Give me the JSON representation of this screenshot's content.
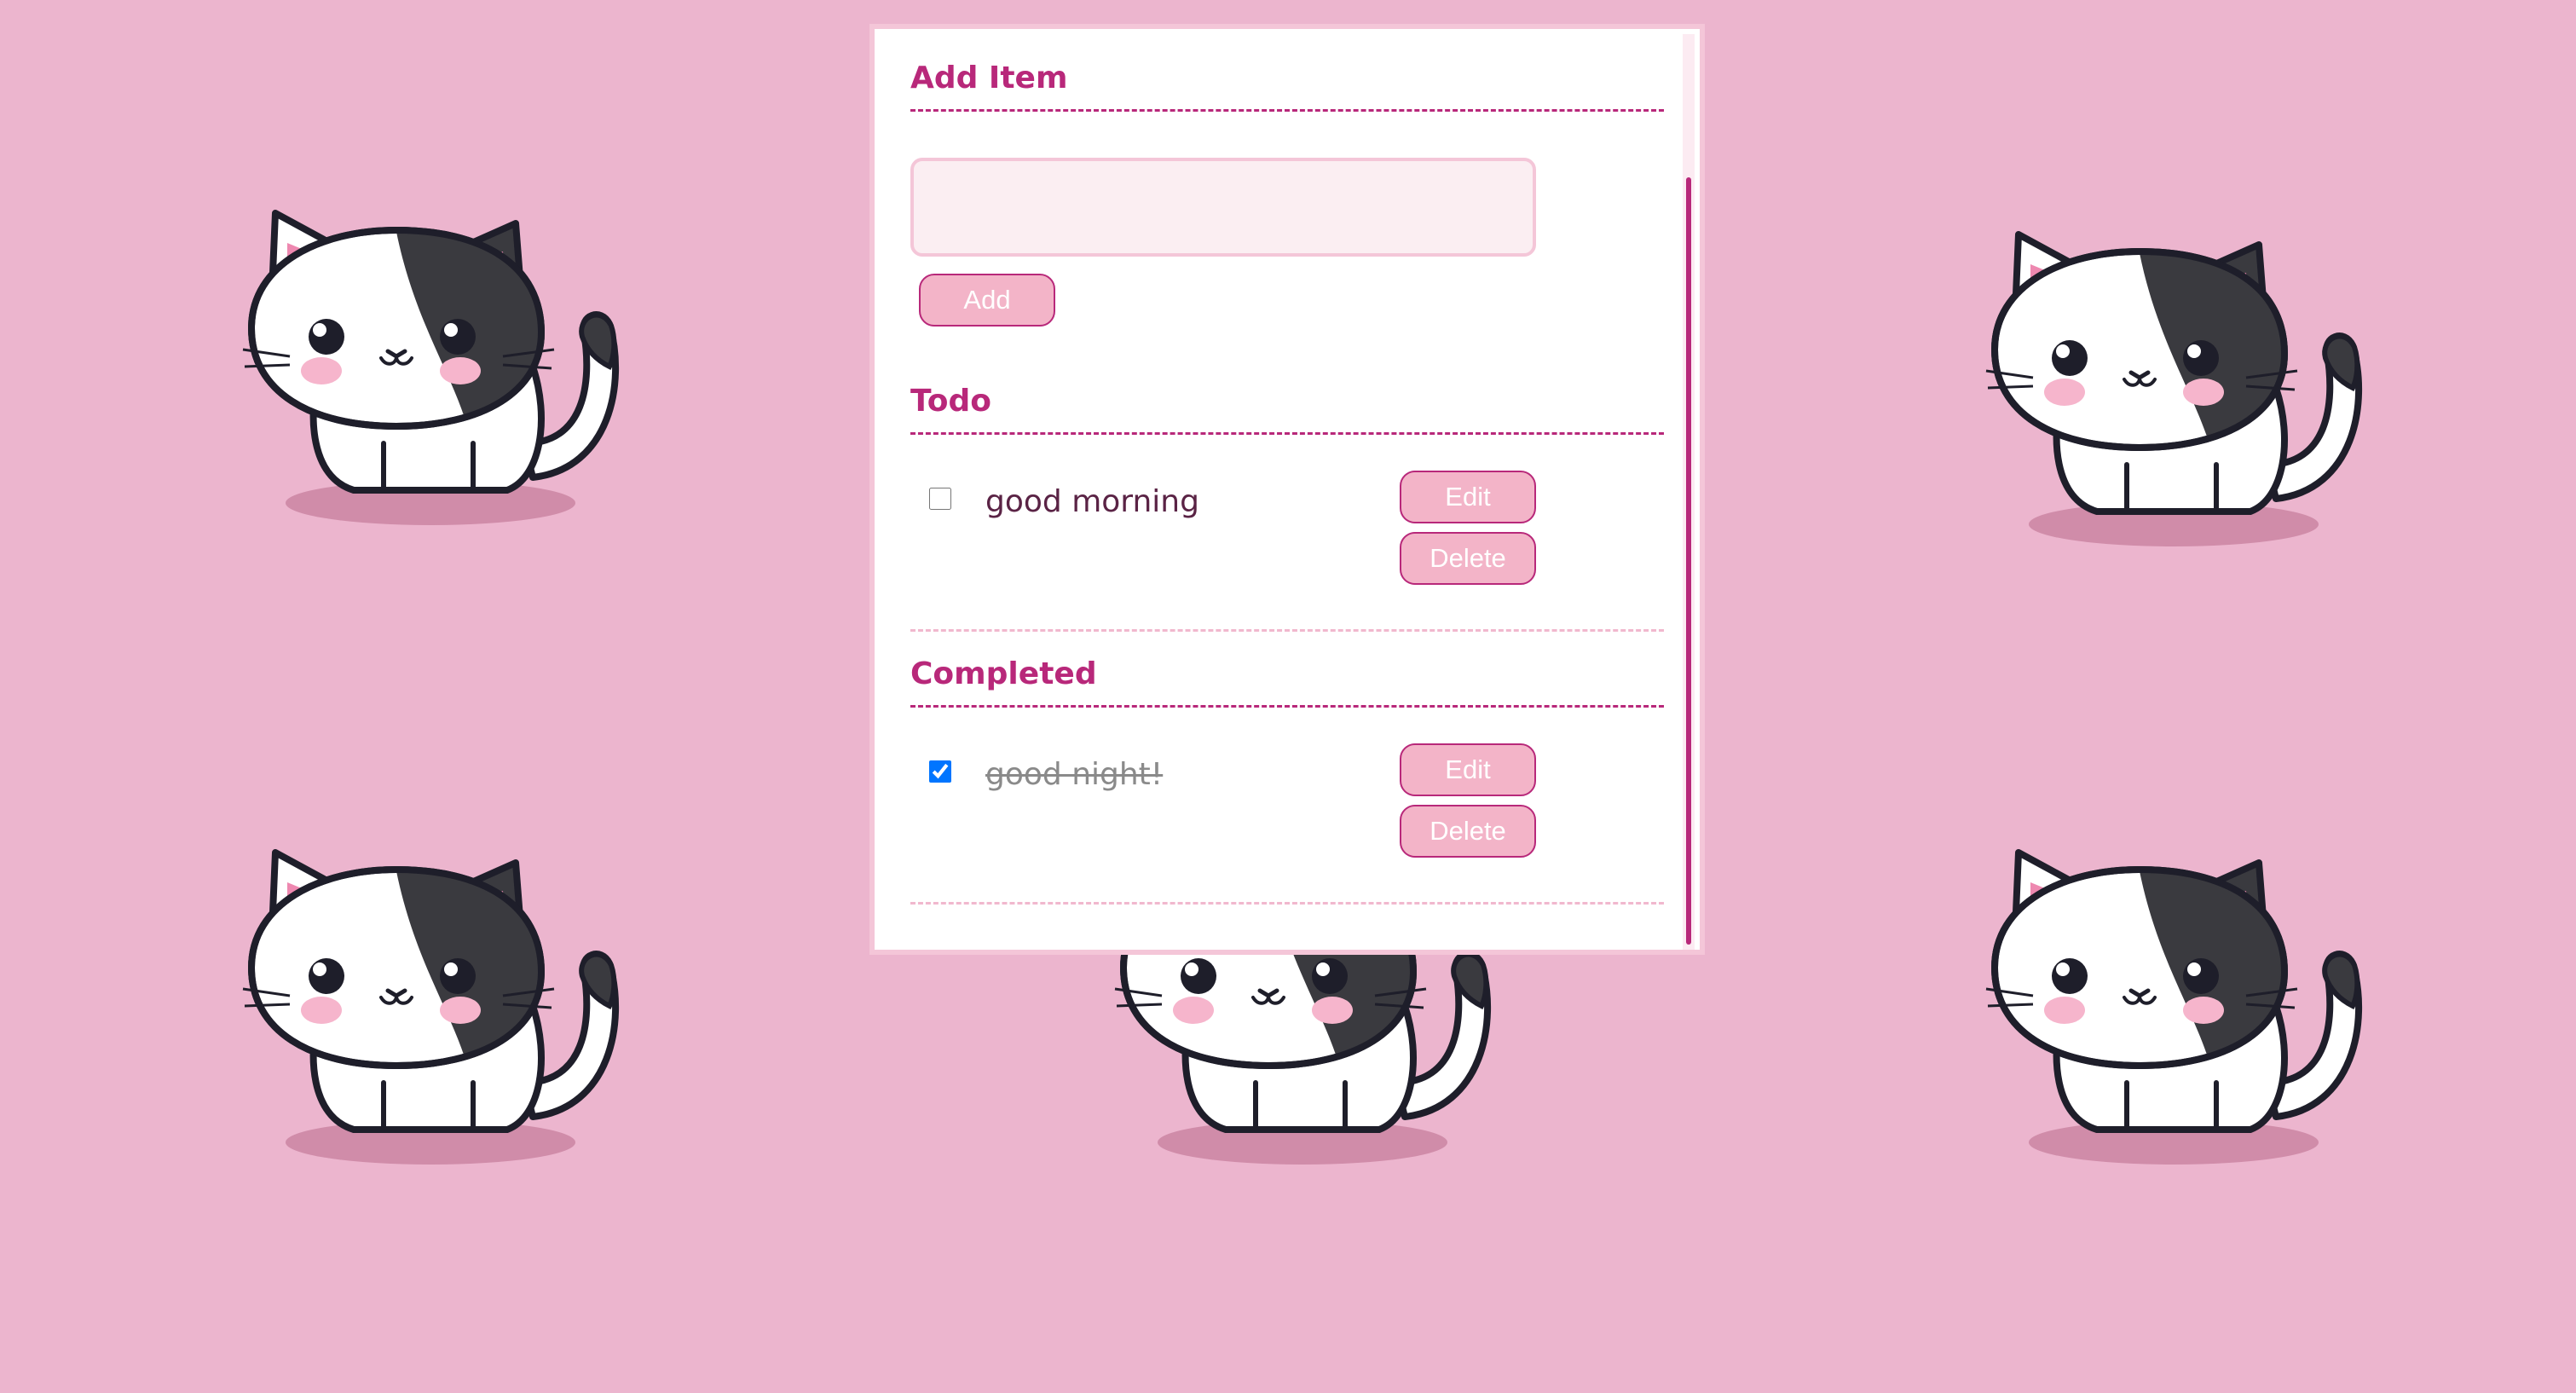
{
  "app": {
    "add_section": {
      "title": "Add Item",
      "input_value": "",
      "add_label": "Add"
    },
    "todo_section": {
      "title": "Todo",
      "items": [
        {
          "text": "good morning",
          "checked": false,
          "edit_label": "Edit",
          "delete_label": "Delete"
        }
      ]
    },
    "completed_section": {
      "title": "Completed",
      "items": [
        {
          "text": "good night!",
          "checked": true,
          "edit_label": "Edit",
          "delete_label": "Delete"
        }
      ]
    }
  },
  "colors": {
    "background": "#ecb5ce",
    "accent": "#b8287a",
    "button_fill": "#f3b4c8",
    "input_fill": "#fbeef2",
    "panel_border": "#f4c6d8"
  },
  "background_icon": "kitten-illustration"
}
